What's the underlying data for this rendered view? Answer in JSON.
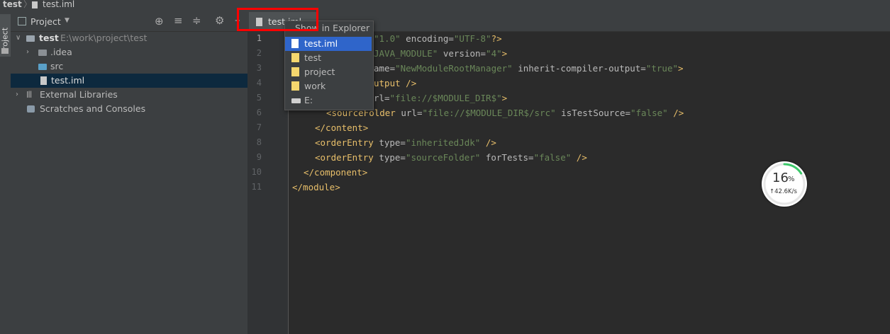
{
  "breadcrumb": {
    "project": "test",
    "separator": "〉",
    "file": "test.iml"
  },
  "tool_window_stripe": {
    "label": "Project"
  },
  "project_panel": {
    "title": "Project",
    "toolbar_icons": [
      "locate-icon",
      "expand-all-icon",
      "collapse-all-icon",
      "gear-icon",
      "minimize-icon"
    ],
    "tree": [
      {
        "name": "test",
        "path": "E:\\work\\project\\test",
        "icon": "module-folder-icon",
        "expanded": true
      },
      {
        "name": ".idea",
        "icon": "folder-icon",
        "expanded": false
      },
      {
        "name": "src",
        "icon": "source-folder-icon"
      },
      {
        "name": "test.iml",
        "icon": "iml-file-icon",
        "selected": true
      },
      {
        "name": "External Libraries",
        "icon": "libraries-icon",
        "expanded": false
      },
      {
        "name": "Scratches and Consoles",
        "icon": "scratches-icon"
      }
    ]
  },
  "editor_tab": {
    "label": "test.iml"
  },
  "popup": {
    "title": "Show in Explorer",
    "items": [
      {
        "label": "test.iml",
        "icon": "file-icon",
        "selected": true
      },
      {
        "label": "test",
        "icon": "folder-icon"
      },
      {
        "label": "project",
        "icon": "folder-icon"
      },
      {
        "label": "work",
        "icon": "folder-icon"
      },
      {
        "label": "E:",
        "icon": "drive-icon"
      }
    ]
  },
  "editor": {
    "line_numbers": [
      "1",
      "2",
      "3",
      "4",
      "5",
      "6",
      "7",
      "8",
      "9",
      "10",
      "11"
    ],
    "visible_fragments": {
      "l1_a": "\"1.0\"",
      "l1_b": " encoding=",
      "l1_c": "\"UTF-8\"",
      "l1_d": "?>",
      "l2_a": "JAVA_MODULE\"",
      "l2_b": " version=",
      "l2_c": "\"4\"",
      "l2_d": ">",
      "l3_a": "ame=",
      "l3_b": "\"NewModuleRootManager\"",
      "l3_c": " inherit-compiler-output=",
      "l3_d": "\"true\"",
      "l3_e": ">",
      "l4_a": "utput",
      "l4_b": " />",
      "l5_a": "rl=",
      "l5_b": "\"file://$MODULE_DIR$\"",
      "l5_c": ">",
      "l6_a": "<sourceFolder",
      "l6_b": " url=",
      "l6_c": "\"file://$MODULE_DIR$/src\"",
      "l6_d": " isTestSource=",
      "l6_e": "\"false\"",
      "l6_f": " />",
      "l7": "</content>",
      "l8_a": "<orderEntry",
      "l8_b": " type=",
      "l8_c": "\"inheritedJdk\"",
      "l8_d": " />",
      "l9_a": "<orderEntry",
      "l9_b": " type=",
      "l9_c": "\"sourceFolder\"",
      "l9_d": " forTests=",
      "l9_e": "\"false\"",
      "l9_f": " />",
      "l10": "</component>",
      "l11": "</module>"
    }
  },
  "network_widget": {
    "percent": "16",
    "percent_sign": "%",
    "speed": "↑42.6K/s"
  },
  "colors": {
    "highlight_border": "#ff0000",
    "selection": "#2f65ca",
    "tag": "#e8bf6a",
    "string": "#6a8759"
  }
}
